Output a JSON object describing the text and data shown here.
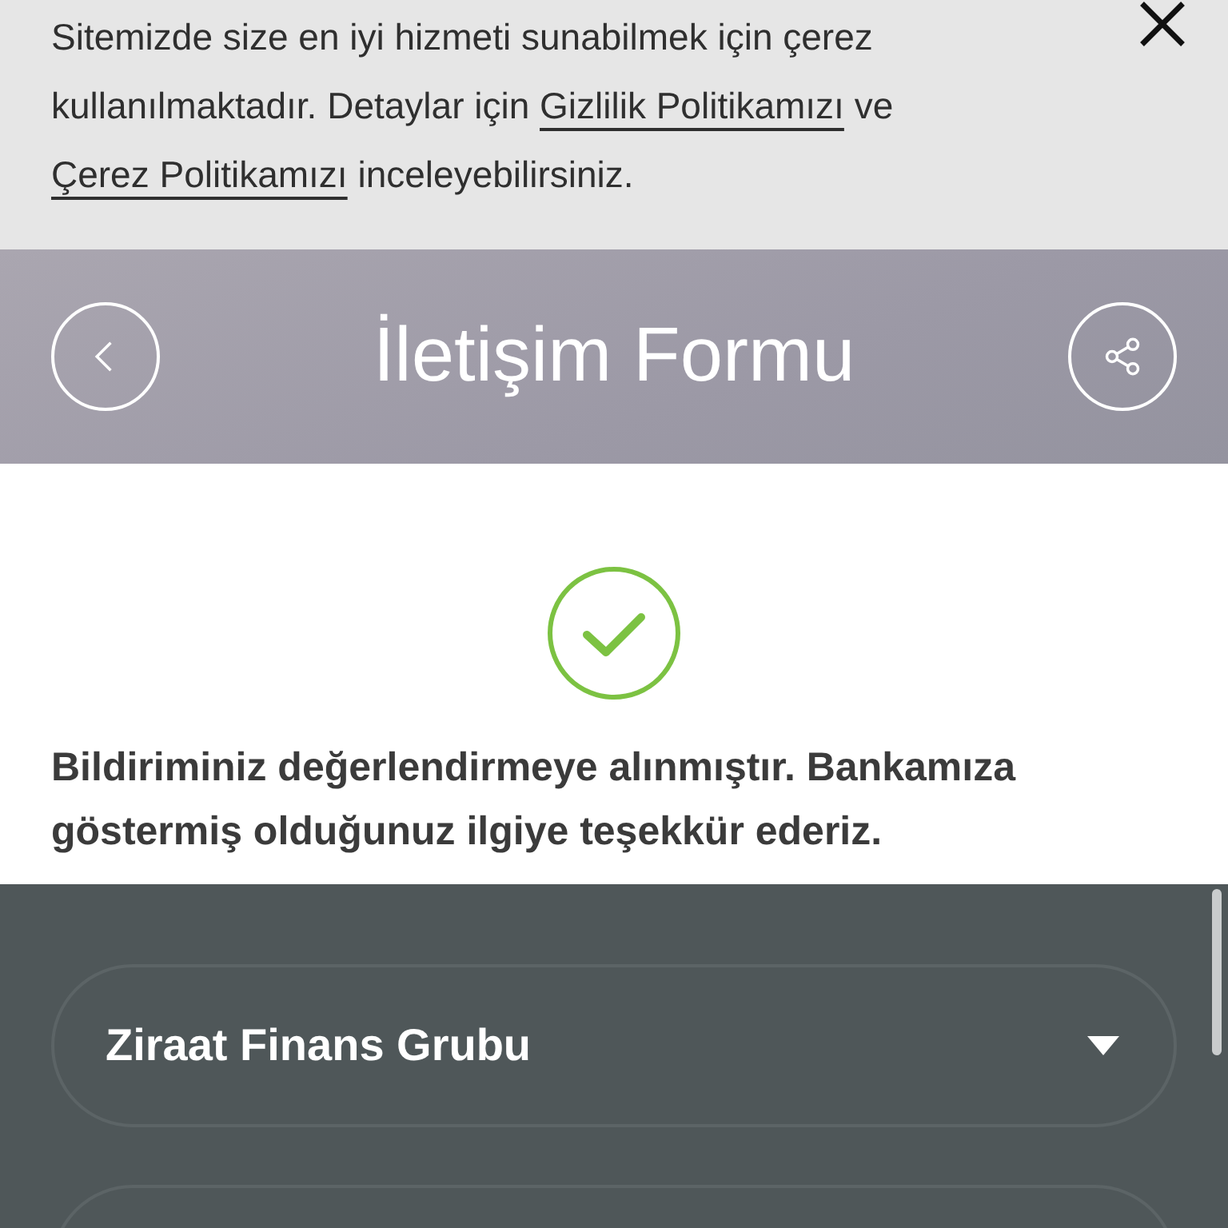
{
  "cookie_banner": {
    "segments": [
      {
        "kind": "text",
        "text": "Sitemizde size en iyi hizmeti sunabilmek için çerez kullanılmaktadır. Detaylar için "
      },
      {
        "kind": "link",
        "text": "Gizlilik Politikamızı"
      },
      {
        "kind": "text",
        "text": " ve "
      },
      {
        "kind": "link",
        "text": "Çerez Politikamızı"
      },
      {
        "kind": "text",
        "text": " inceleyebilirsiniz."
      }
    ]
  },
  "header": {
    "title": "İletişim Formu"
  },
  "confirmation": {
    "message": "Bildiriminiz değerlendirmeye alınmıştır. Bankamıza göstermiş olduğunuz ilgiye teşekkür ederiz."
  },
  "footer": {
    "dropdowns": [
      {
        "value": "Ziraat Finans Grubu"
      }
    ]
  }
}
